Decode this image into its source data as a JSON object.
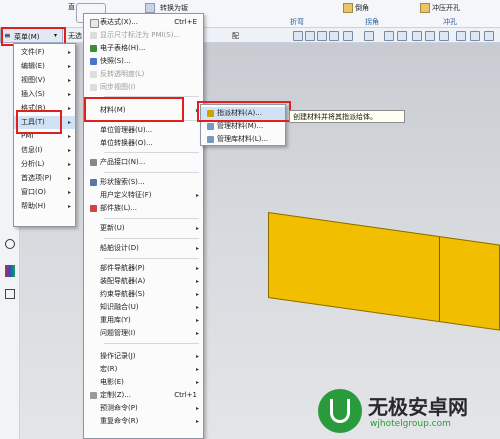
{
  "ribbon": {
    "top_texts": [
      "直",
      "转换为钣",
      "倒角",
      "冲压开孔"
    ],
    "group_labels": [
      "折弯",
      "拐角",
      "冲孔"
    ],
    "toolbar_left_label": "无选",
    "filter_label": "配"
  },
  "menu_button": {
    "label": "菜单(M)",
    "arrow": "▾",
    "icon": "≡"
  },
  "main_menu": {
    "items": [
      {
        "label": "文件(F)"
      },
      {
        "label": "编辑(E)"
      },
      {
        "label": "视图(V)"
      },
      {
        "label": "插入(S)"
      },
      {
        "label": "格式(R)"
      },
      {
        "label": "工具(T)"
      },
      {
        "label": "PMI"
      },
      {
        "label": "信息(I)"
      },
      {
        "label": "分析(L)"
      },
      {
        "label": "首选项(P)"
      },
      {
        "label": "窗口(O)"
      },
      {
        "label": "帮助(H)"
      }
    ]
  },
  "tools_menu": {
    "items": [
      {
        "label": "表达式(X)...",
        "shortcut": "Ctrl+E"
      },
      {
        "label": "显示尺寸标注为 PMI(S)...",
        "disabled": true
      },
      {
        "label": "电子表格(H)..."
      },
      {
        "label": "快照(S)..."
      },
      {
        "label": "反转透明度(L)",
        "disabled": true
      },
      {
        "label": "同步视图(I)",
        "disabled": true
      },
      {
        "label": "材料(M)"
      },
      {
        "label": "单位管理器(U)..."
      },
      {
        "label": "单位转换器(O)..."
      },
      {
        "label": "产品接口(N)..."
      },
      {
        "label": "形状搜索(S)..."
      },
      {
        "label": "用户定义特征(F)"
      },
      {
        "label": "部件族(L)..."
      },
      {
        "label": "更新(U)"
      },
      {
        "label": "船舶设计(D)"
      },
      {
        "label": "部件导航器(P)"
      },
      {
        "label": "装配导航器(A)"
      },
      {
        "label": "约束导航器(S)"
      },
      {
        "label": "知识融合(U)"
      },
      {
        "label": "重用库(Y)"
      },
      {
        "label": "问题管理(I)"
      },
      {
        "label": "操作记录(J)"
      },
      {
        "label": "宏(R)"
      },
      {
        "label": "电影(E)"
      },
      {
        "label": "定制(Z)...",
        "shortcut": "Ctrl+1"
      },
      {
        "label": "预测命令(P)"
      },
      {
        "label": "重复命令(R)"
      }
    ]
  },
  "material_menu": {
    "items": [
      {
        "label": "指派材料(A)..."
      },
      {
        "label": "管理材料(M)..."
      },
      {
        "label": "管理库材料(L)..."
      }
    ]
  },
  "tooltip": {
    "text": "创建材料并将其指派给体。"
  },
  "watermark": {
    "brand": "无极安卓网",
    "url": "wjhotelgroup.com"
  },
  "colors": {
    "highlight_box": "#e0201c",
    "beam": "#f2be00",
    "watermark_green": "#2a9b3c"
  }
}
